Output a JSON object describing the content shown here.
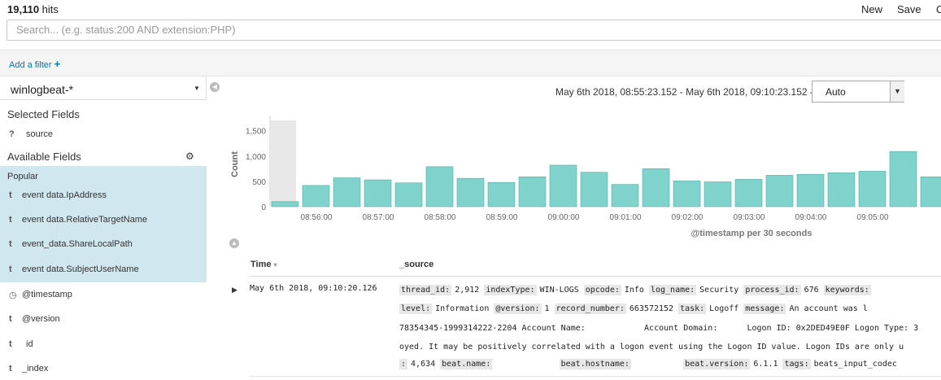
{
  "header": {
    "hits_count": "19,110",
    "hits_label": "hits",
    "new_label": "New",
    "save_label": "Save",
    "open_label": "O"
  },
  "search": {
    "placeholder": "Search... (e.g. status:200 AND extension:PHP)"
  },
  "filter": {
    "add_label": "Add a filter"
  },
  "sidebar": {
    "index_pattern": "winlogbeat-*",
    "selected_heading": "Selected Fields",
    "selected_fields": [
      {
        "type": "?",
        "name": "source"
      }
    ],
    "available_heading": "Available Fields",
    "popular_heading": "Popular",
    "popular_fields": [
      {
        "type": "t",
        "name": "event data.IpAddress"
      },
      {
        "type": "t",
        "name": "event data.RelativeTargetName"
      },
      {
        "type": "t",
        "name": "event_data.ShareLocalPath"
      },
      {
        "type": "t",
        "name": "event data.SubjectUserName"
      }
    ],
    "other_fields": [
      {
        "type": "◷",
        "name": "@timestamp"
      },
      {
        "type": "t",
        "name": "@version"
      },
      {
        "type": "t",
        "name": "id"
      },
      {
        "type": "t",
        "name": "_index"
      }
    ]
  },
  "time_range": {
    "label": "May 6th 2018, 08:55:23.152 - May 6th 2018, 09:10:23.152 —",
    "interval": "Auto"
  },
  "chart_data": {
    "type": "bar",
    "ylabel": "Count",
    "xlabel": "@timestamp per 30 seconds",
    "yticks": [
      "0",
      "500",
      "1,000",
      "1,500"
    ],
    "ylim": [
      0,
      1800
    ],
    "x_tick_labels": [
      "08:56:00",
      "08:57:00",
      "08:58:00",
      "08:59:00",
      "09:00:00",
      "09:01:00",
      "09:02:00",
      "09:03:00",
      "09:04:00",
      "09:05:00"
    ],
    "values": [
      100,
      420,
      570,
      530,
      470,
      790,
      560,
      480,
      590,
      820,
      680,
      440,
      750,
      510,
      490,
      540,
      620,
      640,
      670,
      700,
      1090,
      590
    ],
    "bar_color": "#7fd3cc",
    "partial_bar_color": "#e8e8e8"
  },
  "doc_table": {
    "col_time": "Time",
    "col_source": "_source",
    "rows": [
      {
        "time": "May 6th 2018, 09:10:20.126",
        "lines": [
          [
            [
              "thread_id:",
              "2,912"
            ],
            [
              "indexType:",
              "WIN-LOGS"
            ],
            [
              "opcode:",
              "Info"
            ],
            [
              "log_name:",
              "Security"
            ],
            [
              "process_id:",
              "676"
            ],
            [
              "keywords:",
              ""
            ]
          ],
          [
            [
              "level:",
              "Information"
            ],
            [
              "@version:",
              "1"
            ],
            [
              "record_number:",
              "663572152"
            ],
            [
              "task:",
              "Logoff"
            ],
            [
              "message:",
              "An account was l"
            ]
          ],
          [
            [
              "",
              "78354345-1999314222-2204 Account Name:            Account Domain:      Logon ID: 0x2DED49E0F Logon Type: 3"
            ]
          ],
          [
            [
              "",
              "oyed. It may be positively correlated with a logon event using the Logon ID value. Logon IDs are only u"
            ]
          ],
          [
            [
              ":",
              "4,634"
            ],
            [
              "beat.name:",
              "            "
            ],
            [
              "beat.hostname:",
              "         "
            ],
            [
              "beat.version:",
              "6.1.1"
            ],
            [
              "tags:",
              "beats_input_codec"
            ]
          ]
        ]
      }
    ]
  }
}
